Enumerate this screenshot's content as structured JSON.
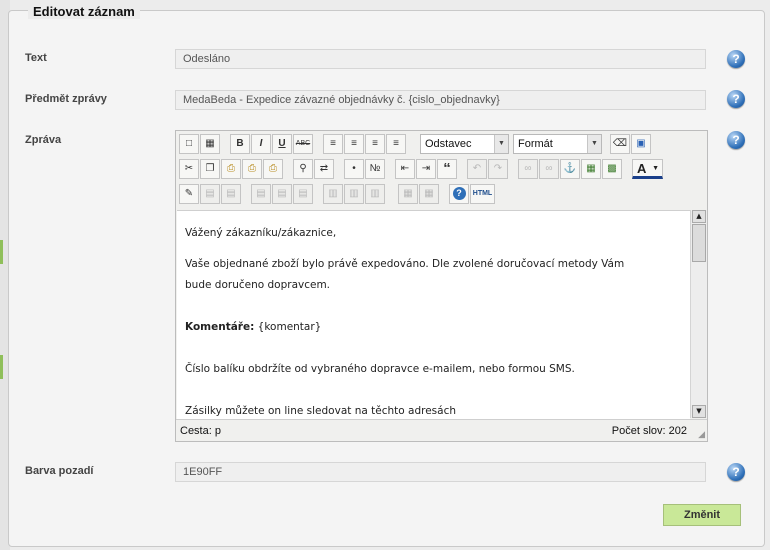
{
  "form": {
    "legend": "Editovat záznam",
    "fields": [
      {
        "label": "Text",
        "value": "Odesláno"
      },
      {
        "label": "Předmět zprávy",
        "value": "MedaBeda - Expedice závazné objednávky č. {cislo_objednavky}"
      },
      {
        "label": "Zpráva"
      },
      {
        "label": "Barva pozadí",
        "value": "1E90FF"
      }
    ],
    "submit_label": "Změnit"
  },
  "editor": {
    "block_format": "Odstavec",
    "style_format": "Formát",
    "toolbar_glyphs": {
      "bold": "B",
      "italic": "I",
      "underline": "U",
      "strike": "ABC",
      "quote": "“",
      "font_color": "A",
      "html": "HTML",
      "help": "?"
    },
    "content": {
      "greeting": "Vážený zákazníku/zákaznice,",
      "line1": "Vaše objednané zboží bylo právě expedováno. Dle zvolené doručovací metody Vám",
      "line2": "bude doručeno dopravcem.",
      "comment_label": "Komentáře:",
      "comment_value": "{komentar}",
      "line3": "Číslo balíku obdržíte od vybraného dopravce e-mailem, nebo formou SMS.",
      "line4": "Zásilky můžete on line sledovat na těchto adresách"
    },
    "status_path": "Cesta: p",
    "word_count": "Počet slov: 202"
  },
  "help_glyph": "?",
  "colors": {
    "accent_green": "#c9e898",
    "help_blue": "#2e6fb8"
  }
}
